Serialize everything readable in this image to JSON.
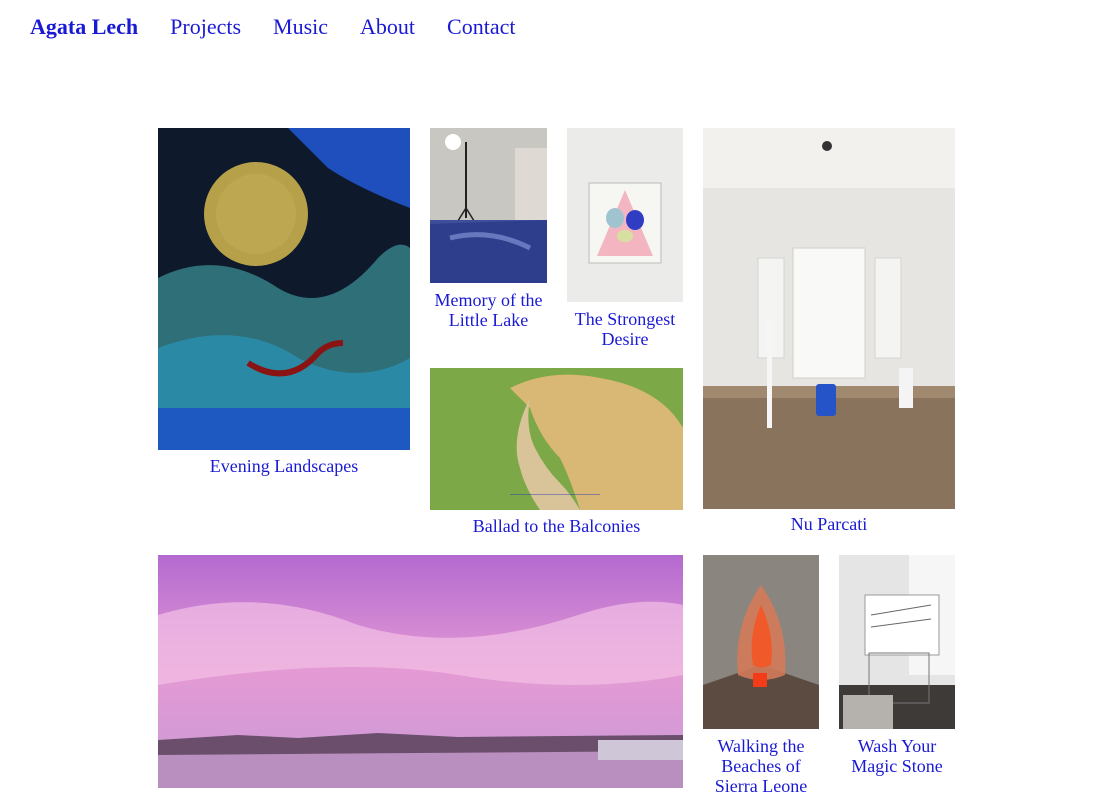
{
  "nav": {
    "brand": "Agata Lech",
    "links": [
      "Projects",
      "Music",
      "About",
      "Contact"
    ]
  },
  "colors": {
    "link": "#1a1ad4",
    "background": "#ffffff"
  },
  "projects": [
    {
      "title": "Evening Landscapes",
      "image": "painting-moon-landscape"
    },
    {
      "title": "Memory of the Little Lake",
      "image": "blue-tarp-installation"
    },
    {
      "title": "The Strongest Desire",
      "image": "framed-drawing"
    },
    {
      "title": "Nu Parcati",
      "image": "white-room-sculptures"
    },
    {
      "title": "Ballad to the Balconies",
      "image": "blonde-profile-grass"
    },
    {
      "title": "Walking the Beaches of Sierra Leone",
      "image": "glowing-corner-installation"
    },
    {
      "title": "Wash Your Magic Stone",
      "image": "drawing-installation"
    },
    {
      "title": "",
      "image": "pink-sky-lagoon"
    }
  ]
}
